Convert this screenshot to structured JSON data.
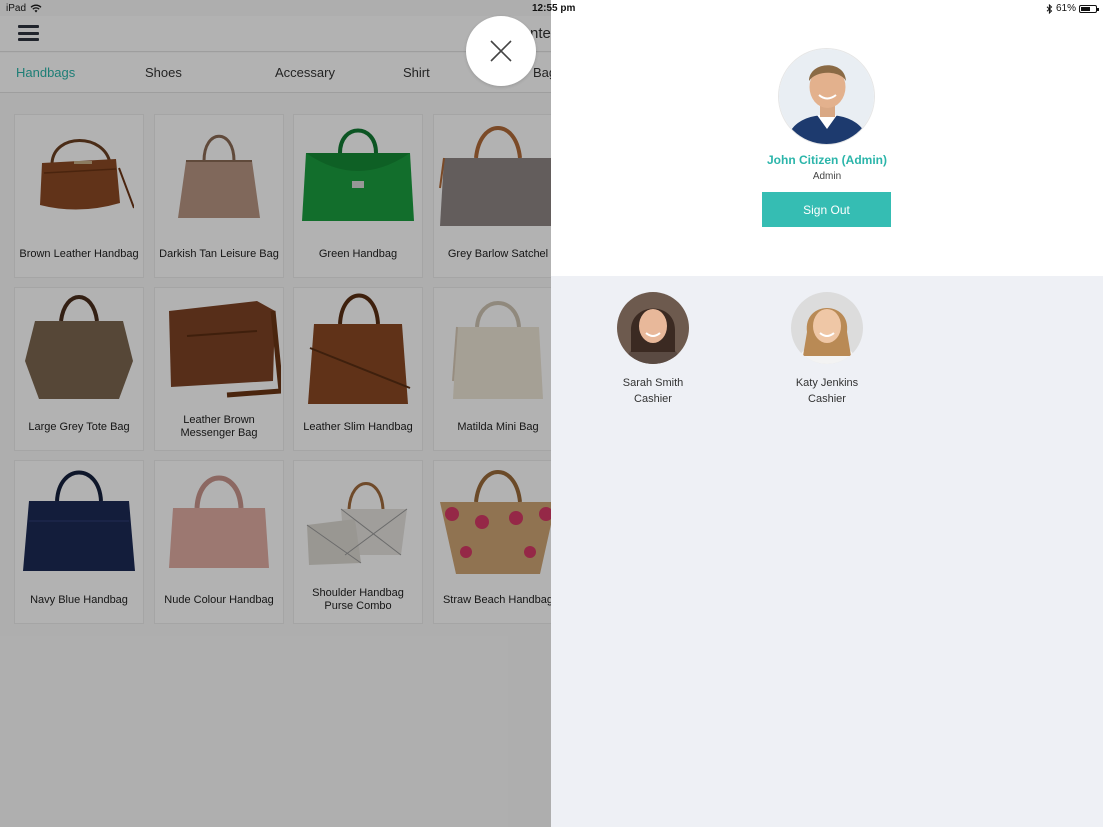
{
  "status_bar": {
    "device": "iPad",
    "time": "12:55 pm",
    "battery": "61%",
    "battery_level": 0.61
  },
  "header": {
    "title_fragment": "nter"
  },
  "tabs": [
    {
      "label": "Handbags",
      "active": true
    },
    {
      "label": "Shoes",
      "active": false
    },
    {
      "label": "Accessary",
      "active": false
    },
    {
      "label": "Shirt",
      "active": false
    },
    {
      "label": "Bag",
      "active": false
    }
  ],
  "products": [
    {
      "name": "Brown Leather Handbag"
    },
    {
      "name": "Darkish Tan Leisure Bag"
    },
    {
      "name": "Green Handbag"
    },
    {
      "name": "Grey Barlow Satchel"
    },
    {
      "name": "Large Grey Tote Bag"
    },
    {
      "name": "Leather Brown Messenger Bag"
    },
    {
      "name": "Leather Slim Handbag"
    },
    {
      "name": "Matilda Mini Bag"
    },
    {
      "name": "Navy Blue Handbag"
    },
    {
      "name": "Nude Colour Handbag"
    },
    {
      "name": "Shoulder Handbag Purse Combo"
    },
    {
      "name": "Straw Beach Handbag"
    }
  ],
  "current_user": {
    "name": "John Citizen (Admin)",
    "role": "Admin",
    "sign_out_label": "Sign Out"
  },
  "staff": [
    {
      "name": "Sarah Smith",
      "role": "Cashier"
    },
    {
      "name": "Katy Jenkins",
      "role": "Cashier"
    }
  ],
  "colors": {
    "accent": "#2bb5aa",
    "button": "#35bdb3",
    "panel_bg": "#eef0f5"
  }
}
